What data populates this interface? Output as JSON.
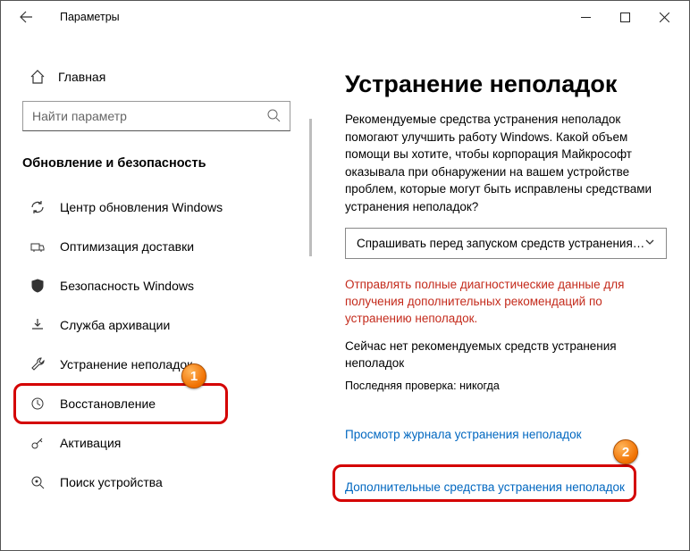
{
  "window": {
    "title": "Параметры"
  },
  "sidebar": {
    "home": "Главная",
    "search_placeholder": "Найти параметр",
    "section": "Обновление и безопасность",
    "items": [
      {
        "label": "Центр обновления Windows"
      },
      {
        "label": "Оптимизация доставки"
      },
      {
        "label": "Безопасность Windows"
      },
      {
        "label": "Служба архивации"
      },
      {
        "label": "Устранение неполадок"
      },
      {
        "label": "Восстановление"
      },
      {
        "label": "Активация"
      },
      {
        "label": "Поиск устройства"
      }
    ]
  },
  "content": {
    "heading": "Устранение неполадок",
    "description": "Рекомендуемые средства устранения неполадок помогают улучшить работу Windows. Какой объем помощи вы хотите, чтобы корпорация Майкрософт оказывала при обнаружении на вашем устройстве проблем, которые могут быть исправлены средствами устранения неполадок?",
    "dropdown_value": "Спрашивать перед запуском средств устранения…",
    "diag_link": "Отправлять полные диагностические данные для получения дополнительных рекомендаций по устранению неполадок.",
    "no_recommended": "Сейчас нет рекомендуемых средств устранения неполадок",
    "last_check": "Последняя проверка: никогда",
    "history_link": "Просмотр журнала устранения неполадок",
    "additional_link": "Дополнительные средства устранения неполадок"
  },
  "annotations": {
    "badge1": "1",
    "badge2": "2"
  }
}
